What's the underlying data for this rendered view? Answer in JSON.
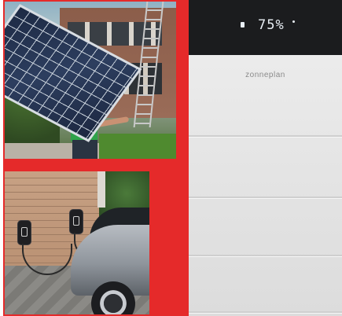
{
  "battery": {
    "display_readout": "75%",
    "brand_label": "zonneplan"
  },
  "colors": {
    "frame_red": "#e52a2a",
    "display_black": "#1b1c1e",
    "battery_body": "#e8e8e8"
  }
}
